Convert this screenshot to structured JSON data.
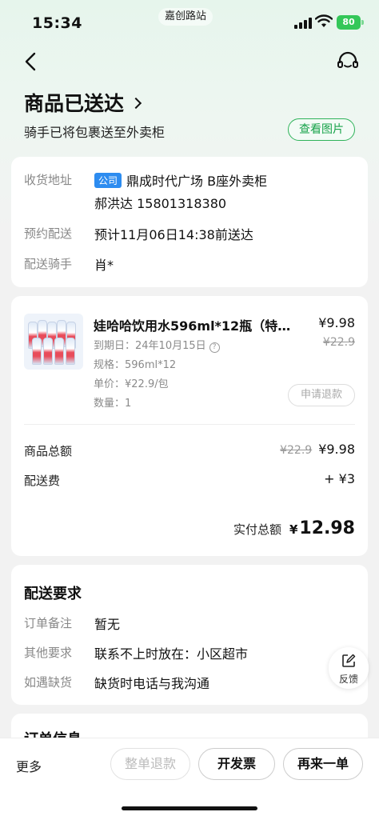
{
  "status_bar": {
    "time": "15:34",
    "station": "嘉创路站",
    "battery": "80"
  },
  "header": {
    "status_title": "商品已送达",
    "status_subtitle": "骑手已将包裹送至外卖柜",
    "view_photo_label": "查看图片"
  },
  "delivery": {
    "address_label": "收货地址",
    "address_tag": "公司",
    "address": "鼎成时代广场 B座外卖柜",
    "contact": "郝洪达 15801318380",
    "schedule_label": "预约配送",
    "schedule_value": "预计11月06日14:38前送达",
    "rider_label": "配送骑手",
    "rider_value": "肖*"
  },
  "product": {
    "name": "娃哈哈饮用水596ml*12瓶（特…",
    "price": "¥9.98",
    "original_price": "¥22.9",
    "expiry": "到期日：24年10月15日",
    "spec": "规格：596ml*12",
    "unit_price": "单价：¥22.9/包",
    "quantity": "数量：1",
    "refund_label": "申请退款"
  },
  "summary": {
    "goods_total_label": "商品总额",
    "goods_total_original": "¥22.9",
    "goods_total": "¥9.98",
    "delivery_fee_label": "配送费",
    "delivery_fee": "+ ¥3",
    "paid_label": "实付总额",
    "paid_currency": "¥",
    "paid_amount": "12.98"
  },
  "requirements": {
    "title": "配送要求",
    "note_label": "订单备注",
    "note_value": "暂无",
    "other_label": "其他要求",
    "other_value": "联系不上时放在：小区超市",
    "stockout_label": "如遇缺货",
    "stockout_value": "缺货时电话与我沟通"
  },
  "order_info": {
    "title": "订单信息"
  },
  "feedback_label": "反馈",
  "bottom_bar": {
    "more_label": "更多",
    "full_refund_label": "整单退款",
    "invoice_label": "开发票",
    "reorder_label": "再来一单"
  },
  "colors": {
    "accent_green": "#17a34a",
    "tag_blue": "#2d8cf0"
  }
}
